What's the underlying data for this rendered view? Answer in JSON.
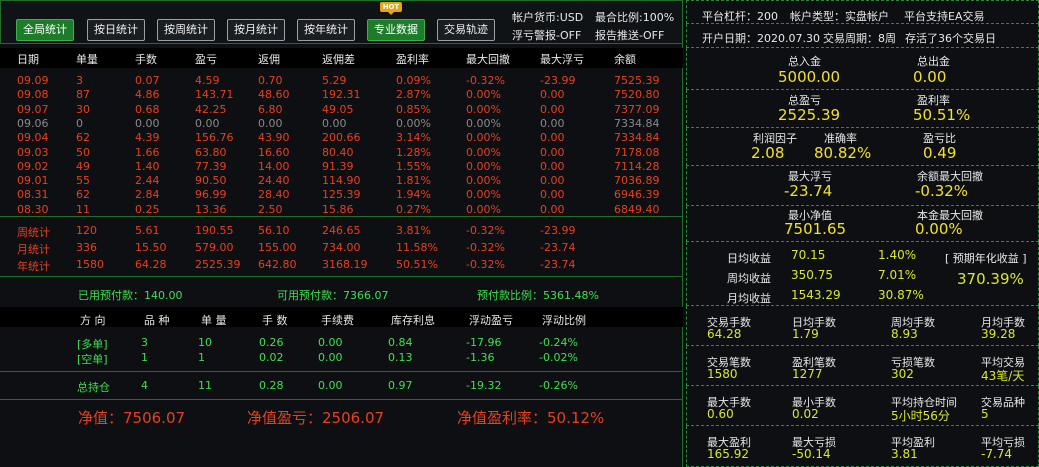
{
  "toolbar": {
    "buttons": [
      "全局统计",
      "按日统计",
      "按周统计",
      "按月统计",
      "按年统计",
      "专业数据",
      "交易轨迹"
    ],
    "hot": "HOT",
    "info": [
      "帐户货币:USD",
      "最合比例:100%",
      "浮亏警报-OFF",
      "报告推送-OFF"
    ]
  },
  "table": {
    "headers": [
      "日期",
      "单量",
      "手数",
      "盈亏",
      "返佣",
      "返佣差",
      "盈利率",
      "最大回撤",
      "最大浮亏",
      "余额"
    ],
    "rows": [
      [
        "09.09",
        "3",
        "0.07",
        "4.59",
        "0.70",
        "5.29",
        "0.09%",
        "-0.32%",
        "-23.99",
        "7525.39"
      ],
      [
        "09.08",
        "87",
        "4.86",
        "143.71",
        "48.60",
        "192.31",
        "2.87%",
        "0.00%",
        "0.00",
        "7520.80"
      ],
      [
        "09.07",
        "30",
        "0.68",
        "42.25",
        "6.80",
        "49.05",
        "0.85%",
        "0.00%",
        "0.00",
        "7377.09"
      ],
      [
        "09.06",
        "0",
        "0.00",
        "0.00",
        "0.00",
        "0.00",
        "0.00%",
        "0.00%",
        "0.00",
        "7334.84"
      ],
      [
        "09.04",
        "62",
        "4.39",
        "156.76",
        "43.90",
        "200.66",
        "3.14%",
        "0.00%",
        "0.00",
        "7334.84"
      ],
      [
        "09.03",
        "50",
        "1.66",
        "63.80",
        "16.60",
        "80.40",
        "1.28%",
        "0.00%",
        "0.00",
        "7178.08"
      ],
      [
        "09.02",
        "49",
        "1.40",
        "77.39",
        "14.00",
        "91.39",
        "1.55%",
        "0.00%",
        "0.00",
        "7114.28"
      ],
      [
        "09.01",
        "55",
        "2.44",
        "90.50",
        "24.40",
        "114.90",
        "1.81%",
        "0.00%",
        "0.00",
        "7036.89"
      ],
      [
        "08.31",
        "62",
        "2.84",
        "96.99",
        "28.40",
        "125.39",
        "1.94%",
        "0.00%",
        "0.00",
        "6946.39"
      ],
      [
        "08.30",
        "11",
        "0.25",
        "13.36",
        "2.50",
        "15.86",
        "0.27%",
        "0.00%",
        "0.00",
        "6849.40"
      ]
    ],
    "summary": [
      [
        "周统计",
        "120",
        "5.61",
        "190.55",
        "56.10",
        "246.65",
        "3.81%",
        "-0.32%",
        "-23.99"
      ],
      [
        "月统计",
        "336",
        "15.50",
        "579.00",
        "155.00",
        "734.00",
        "11.58%",
        "-0.32%",
        "-23.74"
      ],
      [
        "年统计",
        "1580",
        "64.28",
        "2525.39",
        "642.80",
        "3168.19",
        "50.51%",
        "-0.32%",
        "-23.74"
      ]
    ]
  },
  "margin": [
    "已用预付款：140.00",
    "可用预付款：7366.07",
    "预付款比例：5361.48%"
  ],
  "positions": {
    "headers": [
      "方 向",
      "品 种",
      "单 量",
      "手 数",
      "手续费",
      "库存利息",
      "浮动盈亏",
      "浮动比例"
    ],
    "rows": [
      [
        "[多单]",
        "3",
        "10",
        "0.26",
        "0.00",
        "0.84",
        "-17.96",
        "-0.24%"
      ],
      [
        "[空单]",
        "1",
        "1",
        "0.02",
        "0.00",
        "0.13",
        "-1.36",
        "-0.02%"
      ]
    ],
    "total": [
      "总持仓",
      "4",
      "11",
      "0.28",
      "0.00",
      "0.97",
      "-19.32",
      "-0.26%"
    ]
  },
  "bottom": [
    "净值：7506.07",
    "净值盈亏：2506.07",
    "净值盈利率：50.12%"
  ],
  "right": {
    "line1": [
      "平台杠杆：200",
      "帐户类型：实盘帐户",
      "平台支持EA交易"
    ],
    "line2": [
      "开户日期：2020.07.30",
      "交易周期：8周",
      "存活了36个交易日"
    ],
    "stats": [
      [
        "总入金",
        "5000.00",
        "总出金",
        "0.00"
      ],
      [
        "总盈亏",
        "2525.39",
        "盈利率",
        "50.51%"
      ]
    ],
    "three": {
      "labels": [
        "利润因子",
        "准确率",
        "盈亏比"
      ],
      "values": [
        "2.08",
        "80.82%",
        "0.49"
      ]
    },
    "stats2": [
      [
        "最大浮亏",
        "-23.74",
        "余额最大回撤",
        "-0.32%"
      ],
      [
        "最小净值",
        "7501.65",
        "本金最大回撤",
        "0.00%"
      ]
    ],
    "income": [
      [
        "日均收益",
        "70.15",
        "1.40%"
      ],
      [
        "周均收益",
        "350.75",
        "7.01%"
      ],
      [
        "月均收益",
        "1543.29",
        "30.87%"
      ]
    ],
    "annual_label": "[ 预期年化收益 ]",
    "annual_value": "370.39%",
    "grid": [
      [
        [
          "交易手数",
          "64.28"
        ],
        [
          "日均手数",
          "1.79"
        ],
        [
          "周均手数",
          "8.93"
        ],
        [
          "月均手数",
          "39.28"
        ]
      ],
      [
        [
          "交易笔数",
          "1580"
        ],
        [
          "盈利笔数",
          "1277"
        ],
        [
          "亏损笔数",
          "302"
        ],
        [
          "平均交易",
          "43笔/天"
        ]
      ],
      [
        [
          "最大手数",
          "0.60"
        ],
        [
          "最小手数",
          "0.02"
        ],
        [
          "平均持仓时间",
          "5小时56分"
        ],
        [
          "交易品种",
          "5"
        ]
      ],
      [
        [
          "最大盈利",
          "165.92"
        ],
        [
          "最大亏损",
          "-50.14"
        ],
        [
          "平均盈利",
          "3.81"
        ],
        [
          "平均亏损",
          "-7.74"
        ]
      ]
    ]
  }
}
